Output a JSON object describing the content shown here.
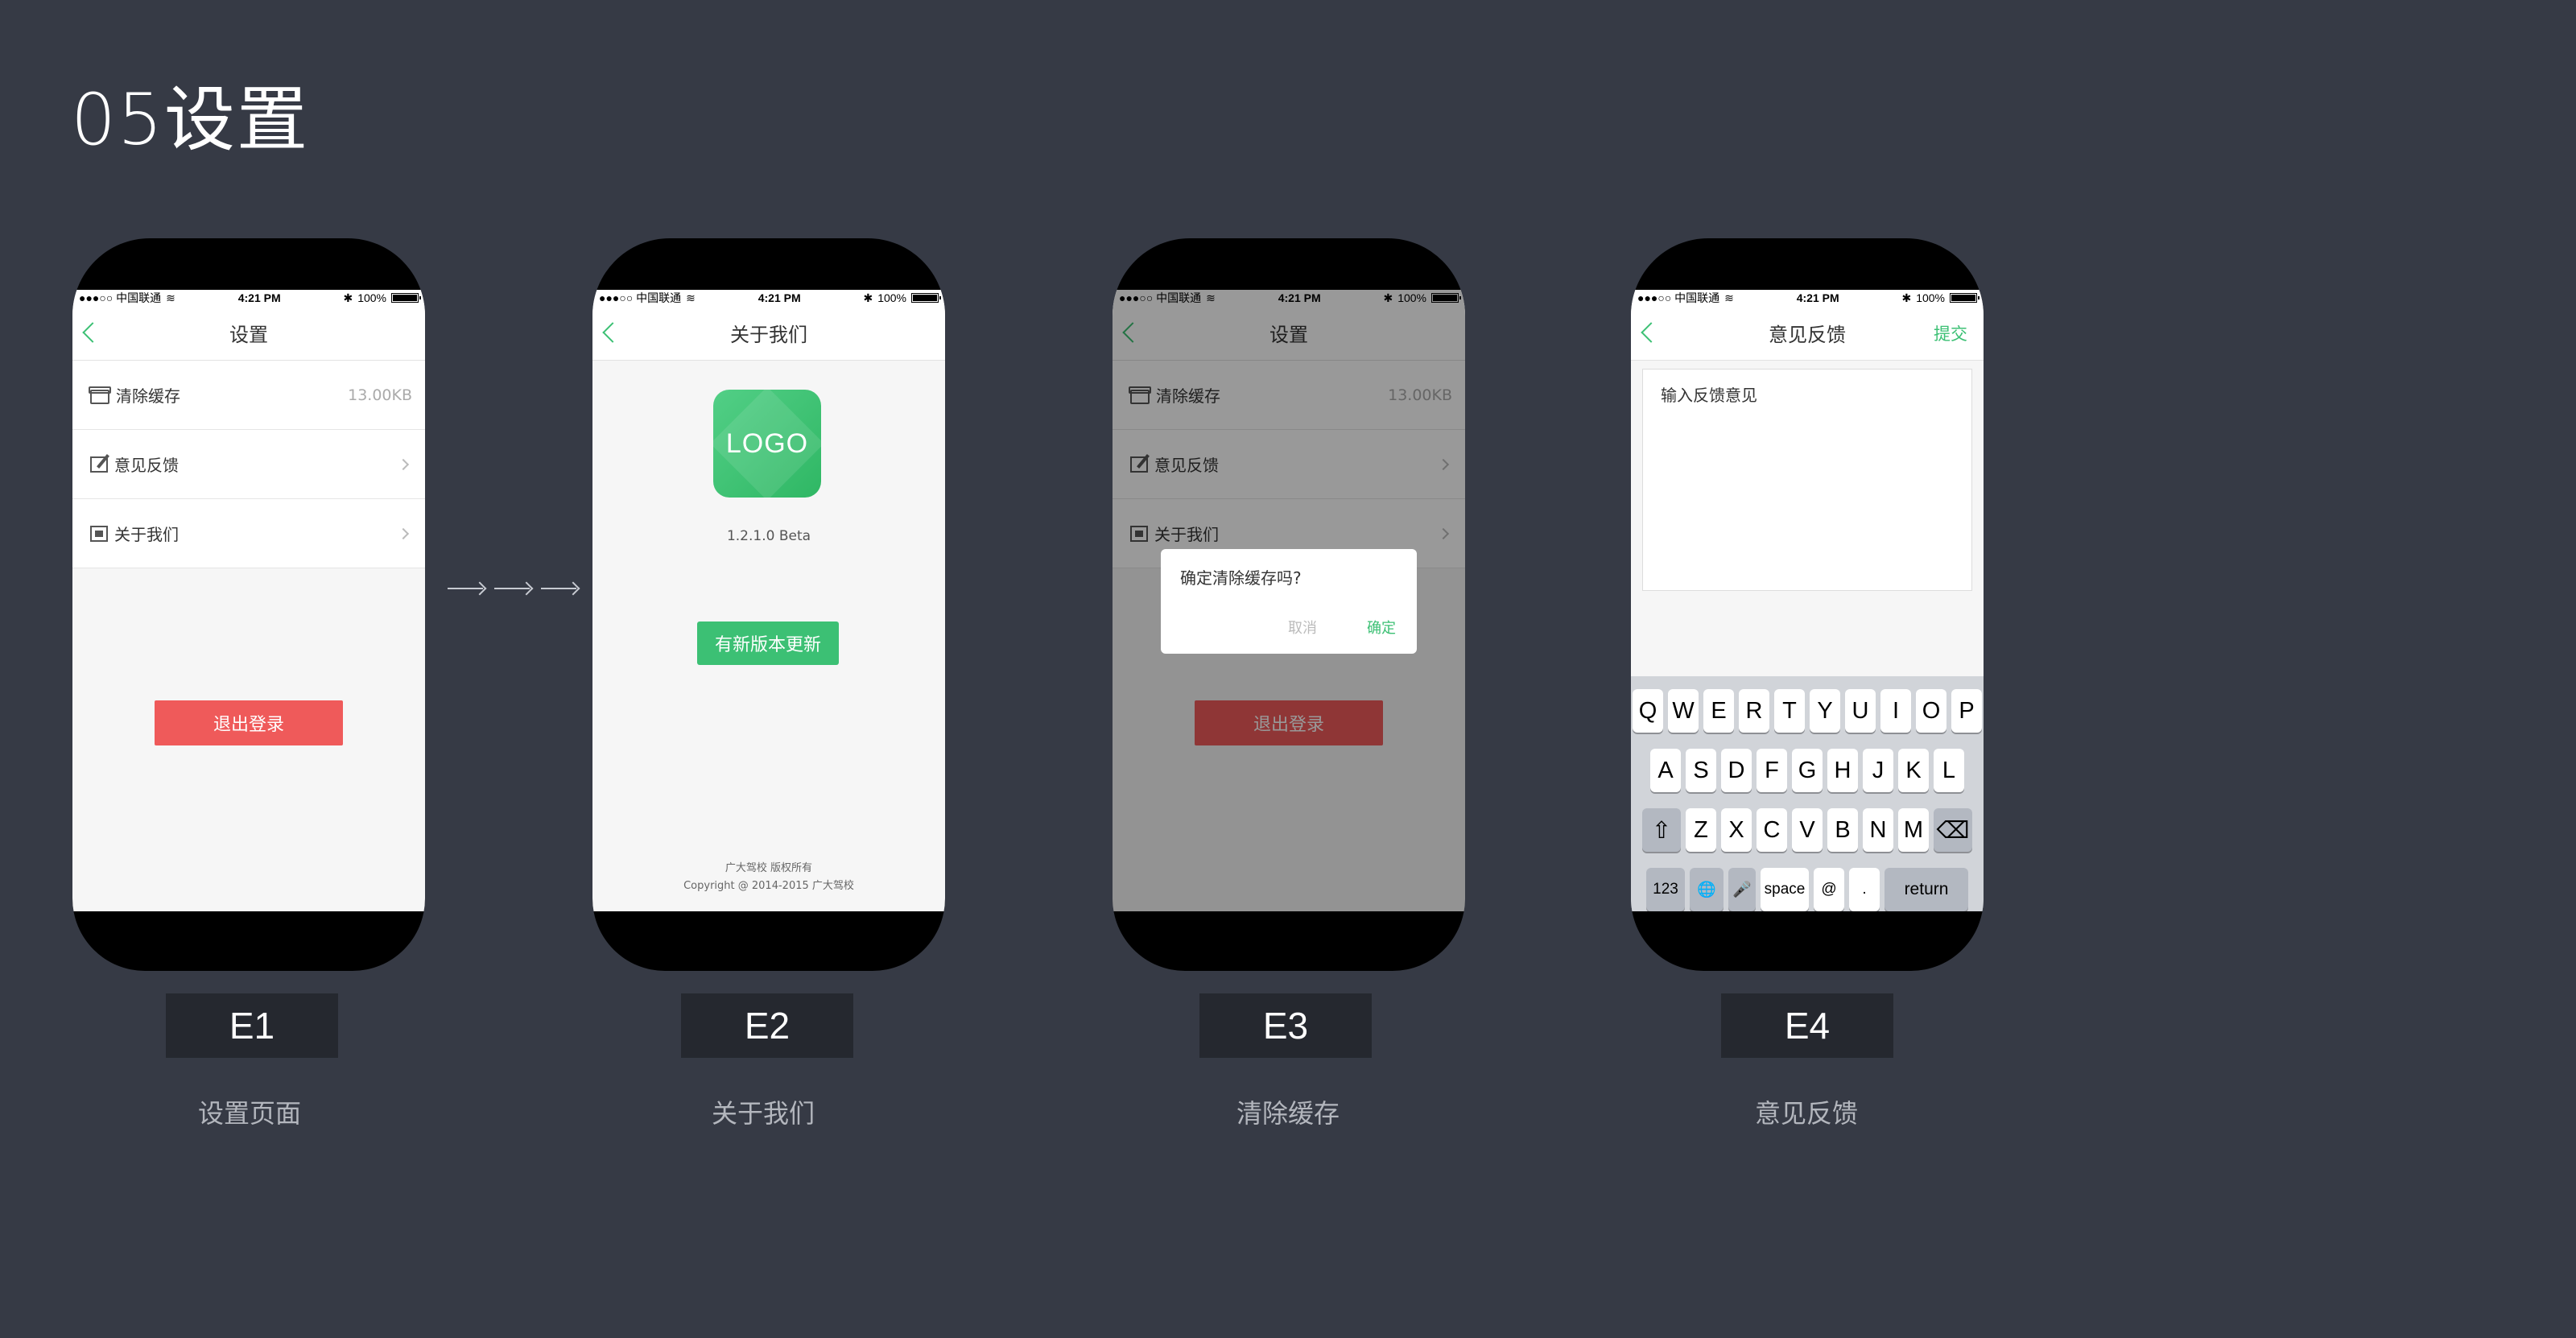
{
  "page_title": "05设置",
  "status": {
    "carrier": "●●●○○ 中国联通",
    "wifi": "≋",
    "time": "4:21 PM",
    "bt": "✱",
    "battery": "100%"
  },
  "e1": {
    "nav_title": "设置",
    "rows": [
      {
        "label": "清除缓存",
        "value": "13.00KB"
      },
      {
        "label": "意见反馈"
      },
      {
        "label": "关于我们"
      }
    ],
    "logout": "退出登录"
  },
  "e2": {
    "nav_title": "关于我们",
    "logo": "LOGO",
    "version": "1.2.1.0 Beta",
    "update": "有新版本更新",
    "copyright_1": "广大驾校 版权所有",
    "copyright_2": "Copyright @ 2014-2015 广大驾校"
  },
  "e3": {
    "dialog_msg": "确定清除缓存吗?",
    "cancel": "取消",
    "ok": "确定"
  },
  "e4": {
    "nav_title": "意见反馈",
    "submit": "提交",
    "placeholder": "输入反馈意见",
    "keys_row1": [
      "Q",
      "W",
      "E",
      "R",
      "T",
      "Y",
      "U",
      "I",
      "O",
      "P"
    ],
    "keys_row2": [
      "A",
      "S",
      "D",
      "F",
      "G",
      "H",
      "J",
      "K",
      "L"
    ],
    "keys_row3": [
      "Z",
      "X",
      "C",
      "V",
      "B",
      "N",
      "M"
    ],
    "shift": "⇧",
    "delete": "⌫",
    "num": "123",
    "globe": "🌐",
    "mic": "🎤",
    "space": "space",
    "at": "@",
    "dot": ".",
    "return": "return"
  },
  "labels": [
    {
      "code": "E1",
      "caption": "设置页面"
    },
    {
      "code": "E2",
      "caption": "关于我们"
    },
    {
      "code": "E3",
      "caption": "清除缓存"
    },
    {
      "code": "E4",
      "caption": "意见反馈"
    }
  ],
  "colors": {
    "background": "#363a45",
    "accent": "#3cc074",
    "danger": "#ef5a5a"
  }
}
